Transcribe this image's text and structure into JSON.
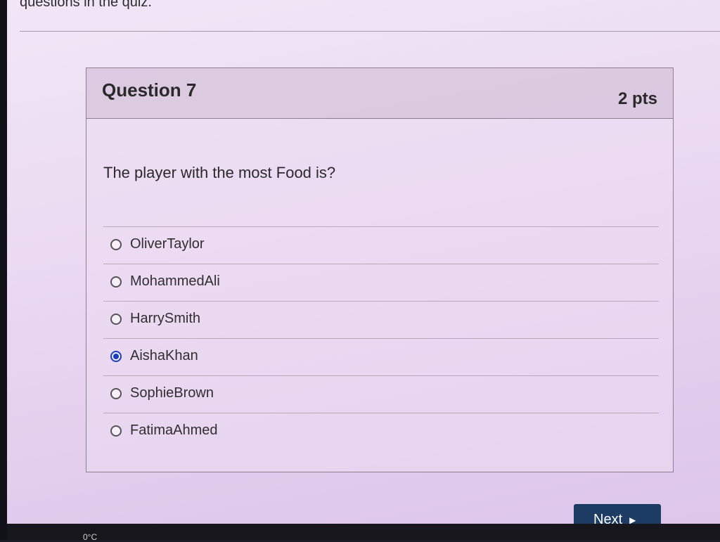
{
  "page": {
    "top_text": "questions in the quiz."
  },
  "question": {
    "title": "Question 7",
    "points": "2 pts",
    "text": "The player with the most Food is?",
    "answers": [
      {
        "label": "OliverTaylor",
        "selected": false
      },
      {
        "label": "MohammedAli",
        "selected": false
      },
      {
        "label": "HarrySmith",
        "selected": false
      },
      {
        "label": "AishaKhan",
        "selected": true
      },
      {
        "label": "SophieBrown",
        "selected": false
      },
      {
        "label": "FatimaAhmed",
        "selected": false
      }
    ]
  },
  "navigation": {
    "next_label": "Next",
    "next_icon": "triangle-right-icon"
  },
  "taskbar": {
    "temperature": "0°C"
  },
  "colors": {
    "accent": "#1b3fbf",
    "button_bg": "#1d3c63"
  }
}
